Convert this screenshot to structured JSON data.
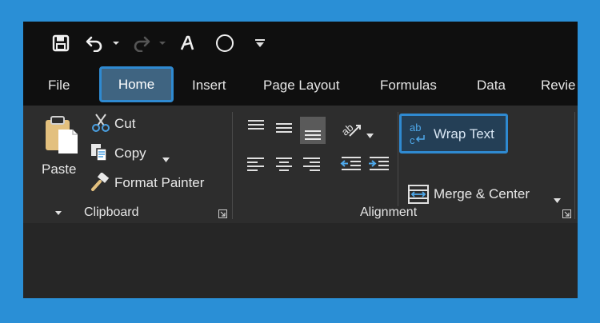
{
  "ribbon_tabs": [
    "File",
    "Home",
    "Insert",
    "Page Layout",
    "Formulas",
    "Data",
    "Revie"
  ],
  "clipboard": {
    "paste_label": "Paste",
    "cut_label": "Cut",
    "copy_label": "Copy",
    "format_painter_label": "Format Painter",
    "group_label": "Clipboard"
  },
  "alignment": {
    "wrap_text_label": "Wrap Text",
    "merge_center_label": "Merge & Center",
    "group_label": "Alignment"
  },
  "icons": {
    "save": "save-icon",
    "undo": "undo-icon",
    "redo": "redo-icon",
    "font_color": "font-color-icon",
    "shape": "circle-icon",
    "customize": "customize-qat-icon"
  },
  "colors": {
    "highlight": "#2f8ad1",
    "frame": "#2a8fd6",
    "ribbon": "#2d2d2d",
    "titlebar": "#0f0f0f"
  }
}
